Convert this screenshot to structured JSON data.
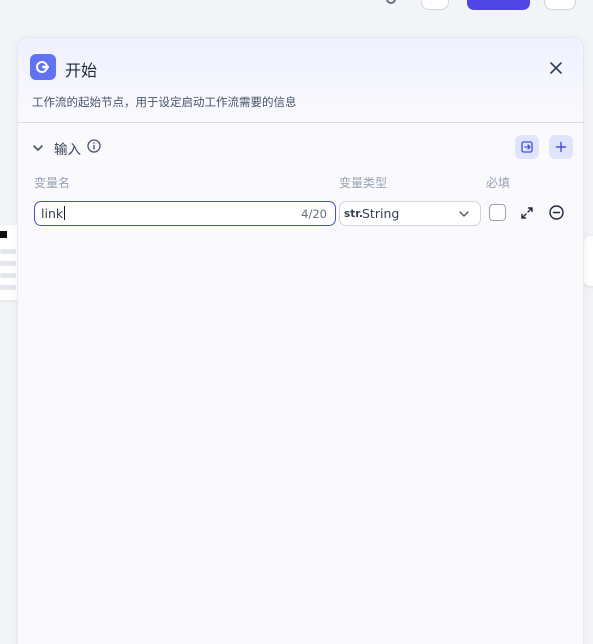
{
  "panel": {
    "title": "开始",
    "description": "工作流的起始节点，用于设定启动工作流需要的信息",
    "section_label": "输入",
    "columns": {
      "name": "变量名",
      "type": "变量类型",
      "required": "必填"
    },
    "variables": [
      {
        "name": "link",
        "counter": "4/20",
        "type_prefix": "str.",
        "type": "String",
        "required": false
      }
    ]
  },
  "colors": {
    "accent": "#444ce7",
    "node_icon_bg": "#6172f3",
    "primary_button": "#4f46e5"
  },
  "icons": {
    "node": "start-node-icon",
    "close": "close-icon",
    "collapse": "chevron-down-icon",
    "info": "info-icon",
    "import": "import-variable-icon",
    "add": "plus-icon",
    "expand": "expand-icon",
    "remove": "remove-circle-icon",
    "dropdown": "chevron-down-icon"
  }
}
